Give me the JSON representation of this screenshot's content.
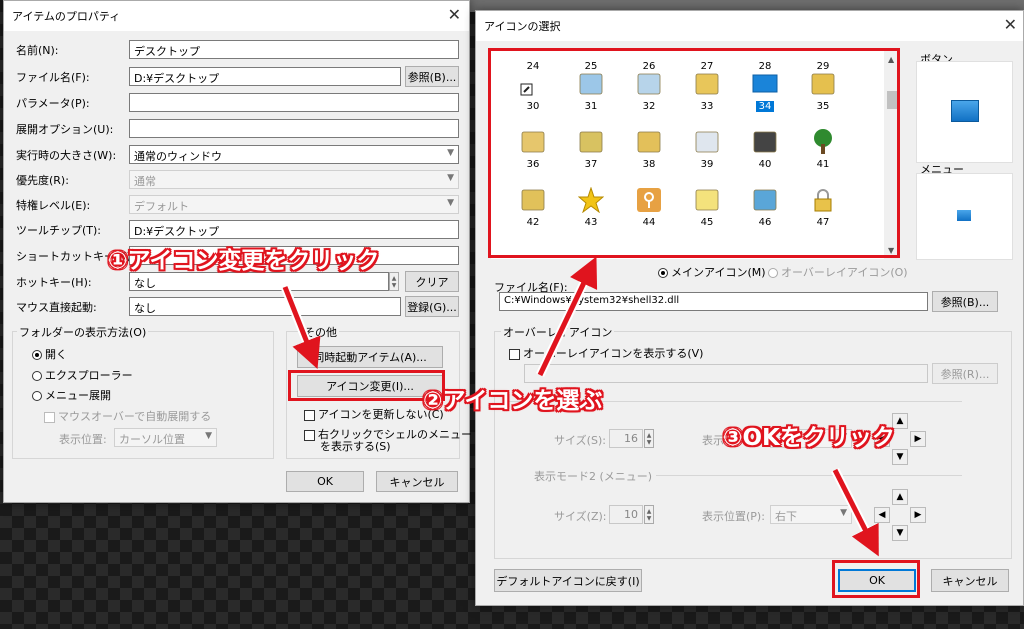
{
  "left": {
    "title": "アイテムのプロパティ",
    "name_label": "名前(N):",
    "name_value": "デスクトップ",
    "file_label": "ファイル名(F):",
    "file_value": "D:¥デスクトップ",
    "browse_btn": "参照(B)...",
    "param_label": "パラメータ(P):",
    "param_value": "",
    "expand_label": "展開オプション(U):",
    "expand_value": "",
    "size_label": "実行時の大きさ(W):",
    "size_value": "通常のウィンドウ",
    "priority_label": "優先度(R):",
    "priority_value": "通常",
    "privilege_label": "特権レベル(E):",
    "privilege_value": "デフォルト",
    "tooltip_label": "ツールチップ(T):",
    "tooltip_value": "D:¥デスクトップ",
    "shortcut_label": "ショートカットキー(K):",
    "hotkey_label": "ホットキー(H):",
    "hotkey_value": "なし",
    "clear_btn": "クリア",
    "mouse_label": "マウス直接起動:",
    "mouse_value": "なし",
    "register_btn": "登録(G)...",
    "folder_group": "フォルダーの表示方法(O)",
    "radio_open": "開く",
    "radio_explorer": "エクスプローラー",
    "radio_menu": "メニュー展開",
    "mouseover_chk": "マウスオーバーで自動展開する",
    "display_pos_label": "表示位置:",
    "display_pos_value": "カーソル位置",
    "other_group": "その他",
    "sync_btn": "同時起動アイテム(A)...",
    "icon_change_btn": "アイコン変更(I)...",
    "no_update_chk": "アイコンを更新しない(C)",
    "right_click_chk_1": "右クリックでシェルのメニュー",
    "right_click_chk_2": "を表示する(S)",
    "ok_btn": "OK",
    "cancel_btn": "キャンセル"
  },
  "right": {
    "title": "アイコンの選択",
    "button_label": "ボタン",
    "menu_label": "メニュー",
    "icons": [
      {
        "n": "24",
        "icon": "top-row-icon"
      },
      {
        "n": "25",
        "icon": "top-row-icon"
      },
      {
        "n": "26",
        "icon": "top-row-icon"
      },
      {
        "n": "27",
        "icon": "top-row-icon"
      },
      {
        "n": "28",
        "icon": "top-row-icon"
      },
      {
        "n": "29",
        "icon": "top-row-icon"
      },
      {
        "n": "30",
        "icon": "shortcut-icon"
      },
      {
        "n": "31",
        "icon": "recycle-bin-full-icon"
      },
      {
        "n": "32",
        "icon": "recycle-bin-icon"
      },
      {
        "n": "33",
        "icon": "folder-share-icon"
      },
      {
        "n": "34",
        "icon": "desktop-icon"
      },
      {
        "n": "35",
        "icon": "folder-tools-icon"
      },
      {
        "n": "36",
        "icon": "folder-grid-icon"
      },
      {
        "n": "37",
        "icon": "printer-folder-icon"
      },
      {
        "n": "38",
        "icon": "font-folder-icon"
      },
      {
        "n": "39",
        "icon": "taskbar-icon"
      },
      {
        "n": "40",
        "icon": "cd-player-icon"
      },
      {
        "n": "41",
        "icon": "tree-icon"
      },
      {
        "n": "42",
        "icon": "computer-folder-icon"
      },
      {
        "n": "43",
        "icon": "star-icon"
      },
      {
        "n": "44",
        "icon": "key-icon"
      },
      {
        "n": "45",
        "icon": "upload-file-icon"
      },
      {
        "n": "46",
        "icon": "network-refresh-icon"
      },
      {
        "n": "47",
        "icon": "lock-icon"
      }
    ],
    "radio_main": "メインアイコン(M)",
    "radio_overlay": "オーバーレイアイコン(O)",
    "filename_label": "ファイル名(F):",
    "filename_value": "C:¥Windows¥System32¥shell32.dll",
    "browse_btn": "参照(B)...",
    "overlay_group": "オーバーレイアイコン",
    "overlay_chk": "オーバーレイアイコンを表示する(V)",
    "browse_btn2": "参照(R)...",
    "size_label": "サイズ(S):",
    "size_value": "16",
    "display_label_cut": "表示",
    "mode2_label": "表示モード2 (メニュー)",
    "size2_label": "サイズ(Z):",
    "size2_value": "10",
    "pos2_label": "表示位置(P):",
    "pos2_value": "右下",
    "default_btn": "デフォルトアイコンに戻す(I)",
    "ok_btn": "OK",
    "cancel_btn": "キャンセル"
  },
  "annotations": {
    "a1": "①アイコン変更をクリック",
    "a2": "②アイコンを選ぶ",
    "a3": "③OKをクリック",
    "color": "#e0141e"
  }
}
